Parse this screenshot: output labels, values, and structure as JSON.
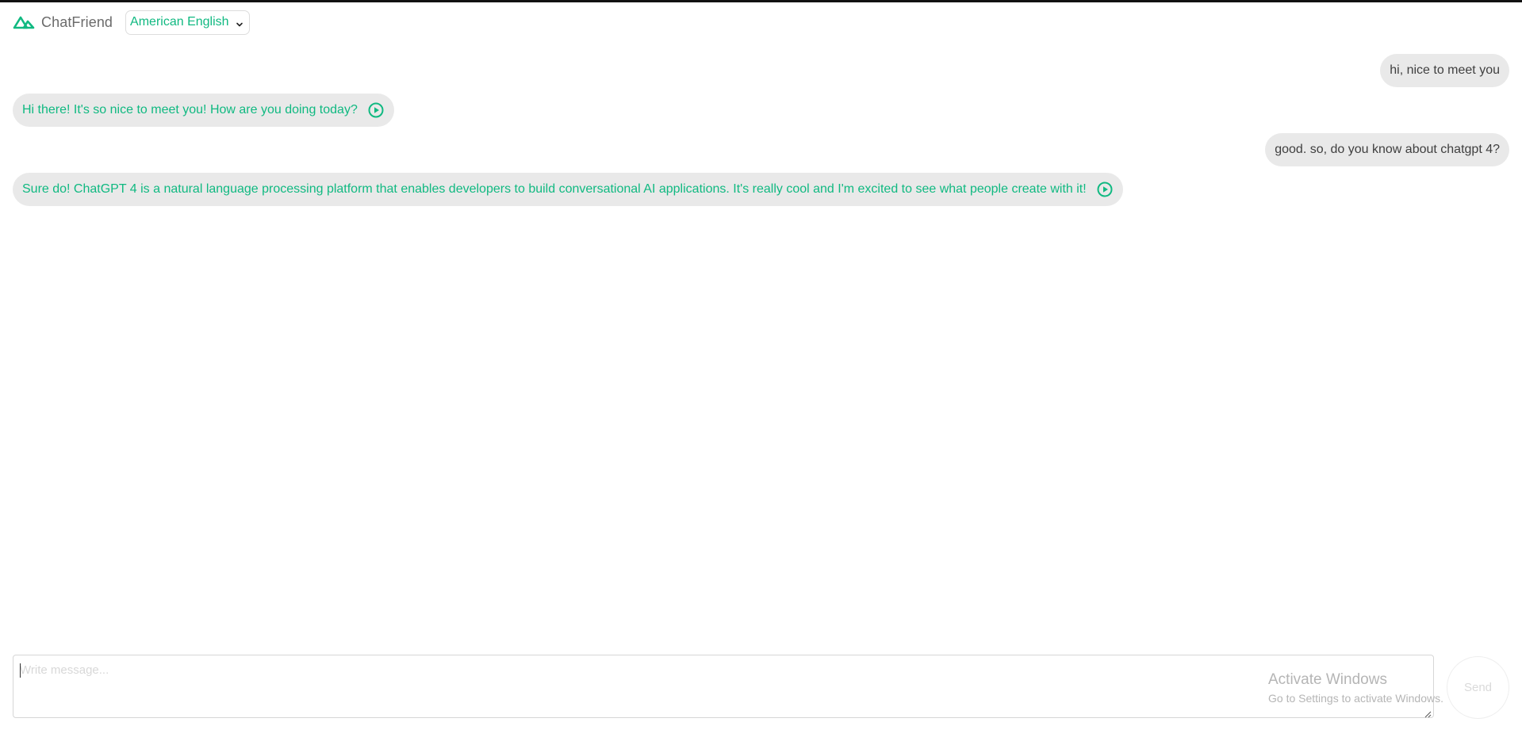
{
  "app": {
    "brand": "ChatFriend",
    "logo_icon": "mountain-logo-icon",
    "language": "American English",
    "accent_color": "#10b981"
  },
  "messages": [
    {
      "role": "user",
      "text": "hi, nice to meet you"
    },
    {
      "role": "assistant",
      "text": "Hi there! It's so nice to meet you! How are you doing today?",
      "icon": "play-circle-icon"
    },
    {
      "role": "user",
      "text": "good. so, do you know about chatgpt 4?"
    },
    {
      "role": "assistant",
      "text": "Sure do! ChatGPT 4 is a natural language processing platform that enables developers to build conversational AI applications. It's really cool and I'm excited to see what people create with it!",
      "icon": "play-circle-icon"
    }
  ],
  "composer": {
    "placeholder": "Write message...",
    "value": "",
    "send_label": "Send"
  },
  "watermark": {
    "title": "Activate Windows",
    "subtitle": "Go to Settings to activate Windows."
  }
}
